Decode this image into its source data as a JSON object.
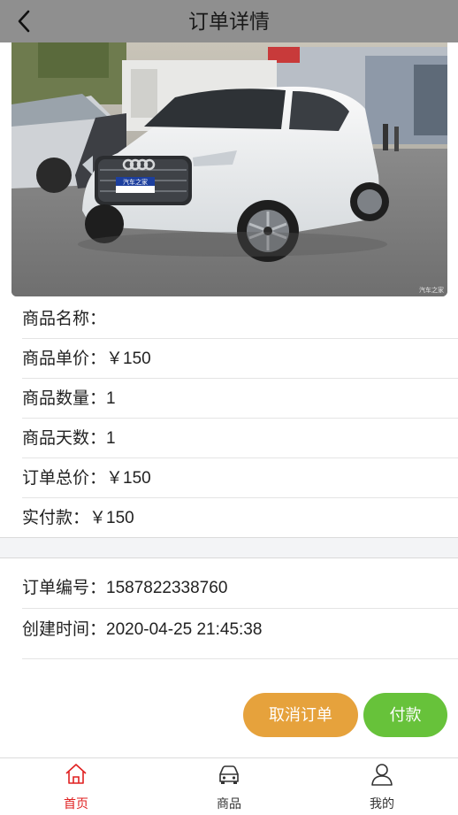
{
  "header": {
    "title": "订单详情",
    "back_icon": "chevron-left-icon"
  },
  "product_image": {
    "watermark": "汽车之家",
    "plate_text": "汽车之家"
  },
  "product_info": [
    {
      "label": "商品名称：",
      "value": ""
    },
    {
      "label": "商品单价：",
      "value": "￥150"
    },
    {
      "label": "商品数量：",
      "value": "1"
    },
    {
      "label": "商品天数：",
      "value": "1"
    },
    {
      "label": "订单总价：",
      "value": "￥150"
    },
    {
      "label": "实付款：",
      "value": "￥150"
    }
  ],
  "order": {
    "number_label": "订单编号：",
    "number": "1587822338760",
    "created_label": "创建时间：",
    "created_at": "2020-04-25 21:45:38"
  },
  "actions": {
    "cancel_label": "取消订单",
    "pay_label": "付款",
    "cancel_color": "#e6a23c",
    "pay_color": "#67c23a"
  },
  "tabbar": {
    "active_color": "#e02020",
    "items": [
      {
        "label": "首页",
        "icon": "home-icon",
        "active": true
      },
      {
        "label": "商品",
        "icon": "car-icon",
        "active": false
      },
      {
        "label": "我的",
        "icon": "user-icon",
        "active": false
      }
    ]
  }
}
